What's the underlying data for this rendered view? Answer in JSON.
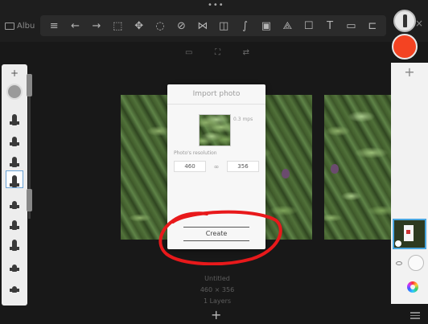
{
  "topbar": {
    "gallery_label": "Albu",
    "tools": [
      {
        "icon": "list-icon",
        "glyph": "≡"
      },
      {
        "icon": "undo-icon",
        "glyph": "←"
      },
      {
        "icon": "redo-icon",
        "glyph": "→"
      },
      {
        "icon": "select-icon",
        "glyph": "⬚"
      },
      {
        "icon": "move-icon",
        "glyph": "✥"
      },
      {
        "icon": "lasso-icon",
        "glyph": "◌"
      },
      {
        "icon": "ruler-icon",
        "glyph": "⊘"
      },
      {
        "icon": "symmetry-icon",
        "glyph": "⋈"
      },
      {
        "icon": "fill-icon",
        "glyph": "◫"
      },
      {
        "icon": "curve-icon",
        "glyph": "∫"
      },
      {
        "icon": "image-icon",
        "glyph": "▣"
      },
      {
        "icon": "perspective-icon",
        "glyph": "⟁"
      },
      {
        "icon": "shape-icon",
        "glyph": "☐"
      },
      {
        "icon": "text-icon",
        "glyph": "T"
      },
      {
        "icon": "video-icon",
        "glyph": "▭"
      },
      {
        "icon": "crop-icon",
        "glyph": "⊏"
      }
    ],
    "close_glyph": "×",
    "more_glyph": "•••"
  },
  "subtools": [
    "▭",
    "⛶",
    "⇄"
  ],
  "puck": {
    "color": "#f44322"
  },
  "brushes": {
    "add_glyph": "+",
    "items": [
      {
        "name": "brush-pencil-icon",
        "height": 14
      },
      {
        "name": "brush-marker-icon",
        "height": 12
      },
      {
        "name": "brush-ink-icon",
        "height": 13
      },
      {
        "name": "brush-pen-icon",
        "height": 15,
        "active": true
      },
      {
        "name": "brush-soft-icon",
        "height": 10
      },
      {
        "name": "brush-airbrush-icon",
        "height": 12
      },
      {
        "name": "brush-paint-icon",
        "height": 14
      },
      {
        "name": "brush-flat-icon",
        "height": 9
      },
      {
        "name": "brush-eraser-icon",
        "height": 8
      }
    ]
  },
  "layers": {
    "add_glyph": "+"
  },
  "dialog": {
    "title": "Import photo",
    "megapixels": "0.3 mps",
    "resolution_label": "Photo's resolution",
    "width_value": "460",
    "link_glyph": "∞",
    "height_value": "356",
    "create_label": "Create"
  },
  "canvas_info": {
    "name": "Untitled",
    "size": "460 × 356",
    "layers": "1 Layers"
  },
  "bottom": {
    "plus_glyph": "+"
  }
}
